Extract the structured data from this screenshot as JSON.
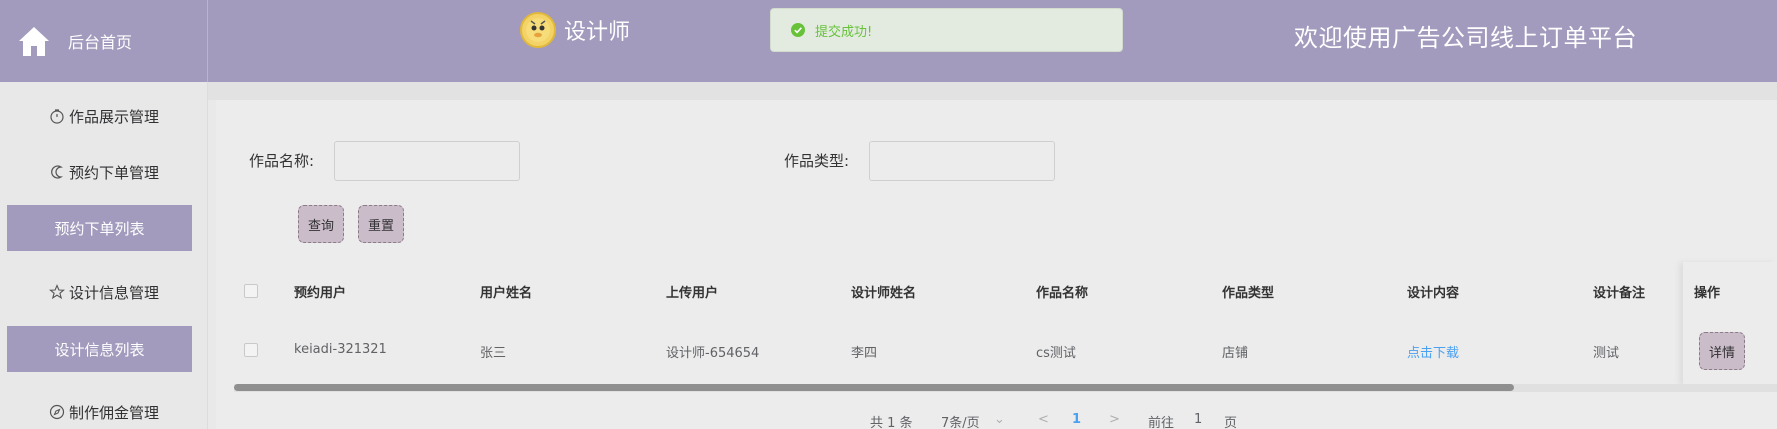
{
  "header": {
    "home_label": "后台首页",
    "role_title": "设计师",
    "toast": "提交成功!",
    "welcome": "欢迎使用广告公司线上订单平台"
  },
  "sidebar": {
    "groups": [
      {
        "label": "作品展示管理",
        "icon": "clock-icon"
      },
      {
        "label": "预约下单管理",
        "icon": "moon-icon"
      },
      {
        "label": "设计信息管理",
        "icon": "star-icon"
      },
      {
        "label": "制作佣金管理",
        "icon": "compass-icon"
      }
    ],
    "items": [
      {
        "label": "预约下单列表"
      },
      {
        "label": "设计信息列表"
      }
    ]
  },
  "search": {
    "name_label": "作品名称:",
    "type_label": "作品类型:",
    "name_value": "",
    "type_value": "",
    "query_button": "查询",
    "reset_button": "重置"
  },
  "table": {
    "columns": [
      "预约用户",
      "用户姓名",
      "上传用户",
      "设计师姓名",
      "作品名称",
      "作品类型",
      "设计内容",
      "设计备注",
      "操作"
    ],
    "rows": [
      {
        "cells": [
          "keiadi-321321",
          "张三",
          "设计师-654654",
          "李四",
          "cs测试",
          "店铺",
          "点击下载",
          "测试"
        ],
        "action": "详情"
      }
    ]
  },
  "pagination": {
    "total": "共 1 条",
    "page_size": "7条/页",
    "prev": "<",
    "current_page": "1",
    "next": ">",
    "goto_label": "前往",
    "goto_value": "1",
    "page_suffix": "页"
  },
  "colors": {
    "header_bg": "#a29bbd",
    "active_menu_bg": "#a29bbd",
    "button_bg": "#cbbcc9",
    "success_green": "#67c23a",
    "link_blue": "#4aa0f1"
  }
}
